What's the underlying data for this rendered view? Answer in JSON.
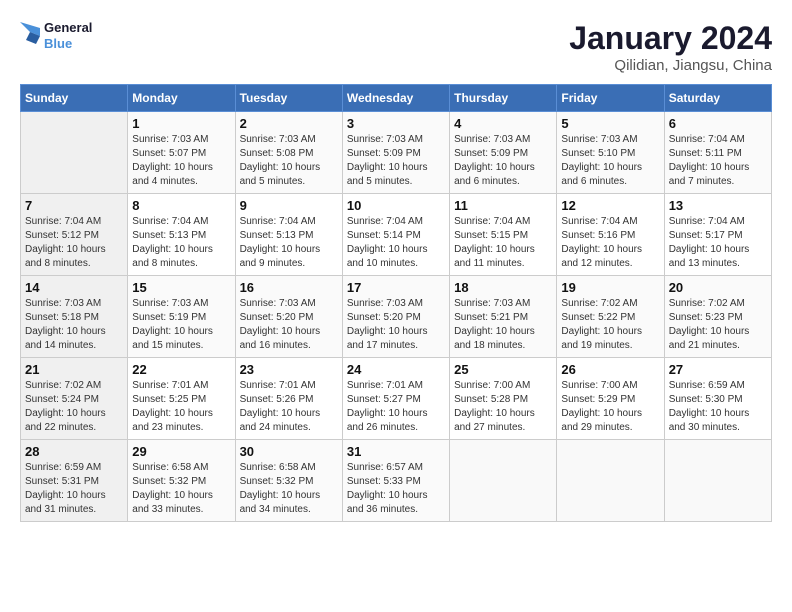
{
  "header": {
    "logo_line1": "General",
    "logo_line2": "Blue",
    "title": "January 2024",
    "subtitle": "Qilidian, Jiangsu, China"
  },
  "days_of_week": [
    "Sunday",
    "Monday",
    "Tuesday",
    "Wednesday",
    "Thursday",
    "Friday",
    "Saturday"
  ],
  "weeks": [
    [
      {
        "day": "",
        "sunrise": "",
        "sunset": "",
        "daylight": ""
      },
      {
        "day": "1",
        "sunrise": "Sunrise: 7:03 AM",
        "sunset": "Sunset: 5:07 PM",
        "daylight": "Daylight: 10 hours and 4 minutes."
      },
      {
        "day": "2",
        "sunrise": "Sunrise: 7:03 AM",
        "sunset": "Sunset: 5:08 PM",
        "daylight": "Daylight: 10 hours and 5 minutes."
      },
      {
        "day": "3",
        "sunrise": "Sunrise: 7:03 AM",
        "sunset": "Sunset: 5:09 PM",
        "daylight": "Daylight: 10 hours and 5 minutes."
      },
      {
        "day": "4",
        "sunrise": "Sunrise: 7:03 AM",
        "sunset": "Sunset: 5:09 PM",
        "daylight": "Daylight: 10 hours and 6 minutes."
      },
      {
        "day": "5",
        "sunrise": "Sunrise: 7:03 AM",
        "sunset": "Sunset: 5:10 PM",
        "daylight": "Daylight: 10 hours and 6 minutes."
      },
      {
        "day": "6",
        "sunrise": "Sunrise: 7:04 AM",
        "sunset": "Sunset: 5:11 PM",
        "daylight": "Daylight: 10 hours and 7 minutes."
      }
    ],
    [
      {
        "day": "7",
        "sunrise": "Sunrise: 7:04 AM",
        "sunset": "Sunset: 5:12 PM",
        "daylight": "Daylight: 10 hours and 8 minutes."
      },
      {
        "day": "8",
        "sunrise": "Sunrise: 7:04 AM",
        "sunset": "Sunset: 5:13 PM",
        "daylight": "Daylight: 10 hours and 8 minutes."
      },
      {
        "day": "9",
        "sunrise": "Sunrise: 7:04 AM",
        "sunset": "Sunset: 5:13 PM",
        "daylight": "Daylight: 10 hours and 9 minutes."
      },
      {
        "day": "10",
        "sunrise": "Sunrise: 7:04 AM",
        "sunset": "Sunset: 5:14 PM",
        "daylight": "Daylight: 10 hours and 10 minutes."
      },
      {
        "day": "11",
        "sunrise": "Sunrise: 7:04 AM",
        "sunset": "Sunset: 5:15 PM",
        "daylight": "Daylight: 10 hours and 11 minutes."
      },
      {
        "day": "12",
        "sunrise": "Sunrise: 7:04 AM",
        "sunset": "Sunset: 5:16 PM",
        "daylight": "Daylight: 10 hours and 12 minutes."
      },
      {
        "day": "13",
        "sunrise": "Sunrise: 7:04 AM",
        "sunset": "Sunset: 5:17 PM",
        "daylight": "Daylight: 10 hours and 13 minutes."
      }
    ],
    [
      {
        "day": "14",
        "sunrise": "Sunrise: 7:03 AM",
        "sunset": "Sunset: 5:18 PM",
        "daylight": "Daylight: 10 hours and 14 minutes."
      },
      {
        "day": "15",
        "sunrise": "Sunrise: 7:03 AM",
        "sunset": "Sunset: 5:19 PM",
        "daylight": "Daylight: 10 hours and 15 minutes."
      },
      {
        "day": "16",
        "sunrise": "Sunrise: 7:03 AM",
        "sunset": "Sunset: 5:20 PM",
        "daylight": "Daylight: 10 hours and 16 minutes."
      },
      {
        "day": "17",
        "sunrise": "Sunrise: 7:03 AM",
        "sunset": "Sunset: 5:20 PM",
        "daylight": "Daylight: 10 hours and 17 minutes."
      },
      {
        "day": "18",
        "sunrise": "Sunrise: 7:03 AM",
        "sunset": "Sunset: 5:21 PM",
        "daylight": "Daylight: 10 hours and 18 minutes."
      },
      {
        "day": "19",
        "sunrise": "Sunrise: 7:02 AM",
        "sunset": "Sunset: 5:22 PM",
        "daylight": "Daylight: 10 hours and 19 minutes."
      },
      {
        "day": "20",
        "sunrise": "Sunrise: 7:02 AM",
        "sunset": "Sunset: 5:23 PM",
        "daylight": "Daylight: 10 hours and 21 minutes."
      }
    ],
    [
      {
        "day": "21",
        "sunrise": "Sunrise: 7:02 AM",
        "sunset": "Sunset: 5:24 PM",
        "daylight": "Daylight: 10 hours and 22 minutes."
      },
      {
        "day": "22",
        "sunrise": "Sunrise: 7:01 AM",
        "sunset": "Sunset: 5:25 PM",
        "daylight": "Daylight: 10 hours and 23 minutes."
      },
      {
        "day": "23",
        "sunrise": "Sunrise: 7:01 AM",
        "sunset": "Sunset: 5:26 PM",
        "daylight": "Daylight: 10 hours and 24 minutes."
      },
      {
        "day": "24",
        "sunrise": "Sunrise: 7:01 AM",
        "sunset": "Sunset: 5:27 PM",
        "daylight": "Daylight: 10 hours and 26 minutes."
      },
      {
        "day": "25",
        "sunrise": "Sunrise: 7:00 AM",
        "sunset": "Sunset: 5:28 PM",
        "daylight": "Daylight: 10 hours and 27 minutes."
      },
      {
        "day": "26",
        "sunrise": "Sunrise: 7:00 AM",
        "sunset": "Sunset: 5:29 PM",
        "daylight": "Daylight: 10 hours and 29 minutes."
      },
      {
        "day": "27",
        "sunrise": "Sunrise: 6:59 AM",
        "sunset": "Sunset: 5:30 PM",
        "daylight": "Daylight: 10 hours and 30 minutes."
      }
    ],
    [
      {
        "day": "28",
        "sunrise": "Sunrise: 6:59 AM",
        "sunset": "Sunset: 5:31 PM",
        "daylight": "Daylight: 10 hours and 31 minutes."
      },
      {
        "day": "29",
        "sunrise": "Sunrise: 6:58 AM",
        "sunset": "Sunset: 5:32 PM",
        "daylight": "Daylight: 10 hours and 33 minutes."
      },
      {
        "day": "30",
        "sunrise": "Sunrise: 6:58 AM",
        "sunset": "Sunset: 5:32 PM",
        "daylight": "Daylight: 10 hours and 34 minutes."
      },
      {
        "day": "31",
        "sunrise": "Sunrise: 6:57 AM",
        "sunset": "Sunset: 5:33 PM",
        "daylight": "Daylight: 10 hours and 36 minutes."
      },
      {
        "day": "",
        "sunrise": "",
        "sunset": "",
        "daylight": ""
      },
      {
        "day": "",
        "sunrise": "",
        "sunset": "",
        "daylight": ""
      },
      {
        "day": "",
        "sunrise": "",
        "sunset": "",
        "daylight": ""
      }
    ]
  ]
}
